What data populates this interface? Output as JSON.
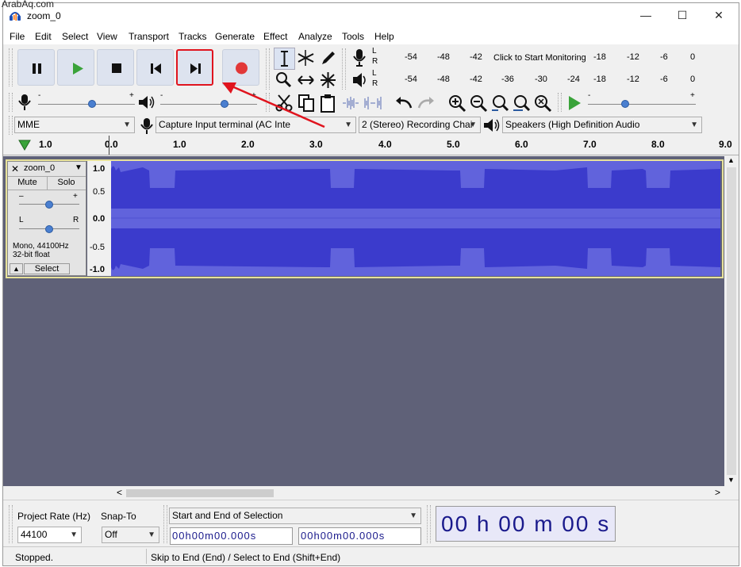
{
  "watermark": "ArabAq.com",
  "window": {
    "title": "zoom_0",
    "min": "—",
    "max": "☐",
    "close": "✕"
  },
  "menu": [
    "File",
    "Edit",
    "Select",
    "View",
    "Transport",
    "Tracks",
    "Generate",
    "Effect",
    "Analyze",
    "Tools",
    "Help"
  ],
  "transport": {
    "pause": "pause-icon",
    "play": "play-icon",
    "stop": "stop-icon",
    "skip_start": "skip-to-start-icon",
    "skip_end": "skip-to-end-icon",
    "record": "record-icon",
    "highlight_color": "#e0141e",
    "annotation_arrow_color": "#e0141e"
  },
  "meters": {
    "record_scale": [
      "-54",
      "-48",
      "-42",
      "Click to Start Monitoring",
      "-18",
      "-12",
      "-6",
      "0"
    ],
    "play_scale": [
      "-54",
      "-48",
      "-42",
      "-36",
      "-30",
      "-24",
      "-18",
      "-12",
      "-6",
      "0"
    ],
    "lr": [
      "L",
      "R"
    ]
  },
  "devices": {
    "host": "MME",
    "input": "Capture Input terminal (AC Inte",
    "channels": "2 (Stereo) Recording Chai",
    "output": "Speakers (High Definition Audio"
  },
  "ruler": {
    "ticks": [
      "1.0",
      "0.0",
      "1.0",
      "2.0",
      "3.0",
      "4.0",
      "5.0",
      "6.0",
      "7.0",
      "8.0",
      "9.0"
    ]
  },
  "track": {
    "name": "zoom_0",
    "close": "✕",
    "menu_arrow": "▼",
    "mute": "Mute",
    "solo": "Solo",
    "gain_minus": "–",
    "gain_plus": "+",
    "pan_l": "L",
    "pan_r": "R",
    "info_line1": "Mono, 44100Hz",
    "info_line2": "32-bit float",
    "collapse": "▲",
    "select": "Select",
    "scale": [
      "1.0",
      "0.5",
      "0.0",
      "-0.5",
      "-1.0"
    ],
    "wave_color": "#3c3ccf",
    "wave_bg": "#5d5fd6"
  },
  "scroll": {
    "left": "<",
    "right": ">",
    "up": "▲",
    "down": "▼"
  },
  "bottom": {
    "project_rate_label": "Project Rate (Hz)",
    "project_rate_value": "44100",
    "snap_label": "Snap-To",
    "snap_value": "Off",
    "selection_mode": "Start and End of Selection",
    "start_time": "00h00m00.000s",
    "end_time": "00h00m00.000s",
    "audio_position": "00 h 00 m 00 s"
  },
  "status": {
    "state": "Stopped.",
    "hint": "Skip to End (End) / Select to End (Shift+End)"
  }
}
